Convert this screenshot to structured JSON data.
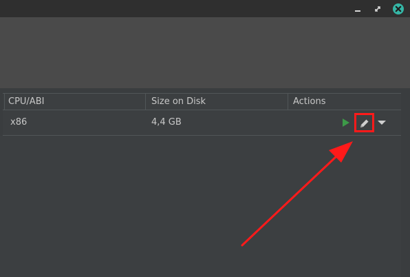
{
  "window": {
    "controls": [
      "minimize-icon",
      "maximize-icon",
      "close-icon"
    ]
  },
  "table": {
    "headers": [
      "CPU/ABI",
      "Size on Disk",
      "Actions"
    ],
    "rows": [
      {
        "cpu_abi": "x86",
        "size_on_disk": "4,4 GB"
      }
    ]
  },
  "actions": {
    "icons": [
      "play-icon",
      "edit-icon",
      "dropdown-arrow-icon"
    ]
  },
  "colors": {
    "play_green": "#3d9a48",
    "highlight_red": "#ff1a1a",
    "close_teal": "#35b6a6"
  }
}
